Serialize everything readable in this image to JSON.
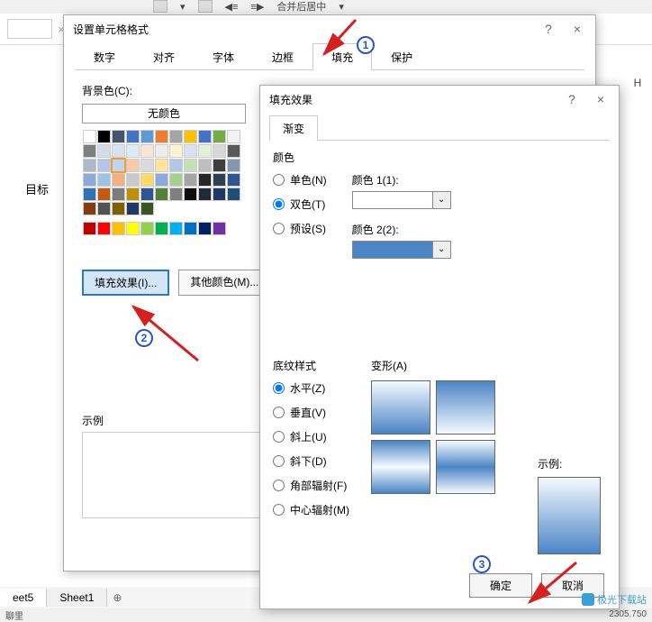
{
  "ribbon": {
    "merge_center": "合并后居中"
  },
  "spreadsheet": {
    "col_H": "H",
    "cell_label": "目标",
    "sheets": [
      "eet5",
      "Sheet1"
    ],
    "status_left": "聊里",
    "status_right": "2305.750"
  },
  "dialog1": {
    "title": "设置单元格格式",
    "help": "?",
    "close": "×",
    "tabs": [
      "数字",
      "对齐",
      "字体",
      "边框",
      "填充",
      "保护"
    ],
    "bg_color_label": "背景色(C):",
    "no_color": "无颜色",
    "fill_effects_btn": "填充效果(I)...",
    "other_colors_btn": "其他颜色(M)...",
    "example_label": "示例"
  },
  "dialog2": {
    "title": "填充效果",
    "help": "?",
    "close": "×",
    "gradient_tab": "渐变",
    "color_section": "颜色",
    "radio_one": "单色(N)",
    "radio_two": "双色(T)",
    "radio_preset": "预设(S)",
    "color1_label": "颜色 1(1):",
    "color2_label": "颜色 2(2):",
    "color2_value": "#4a85c5",
    "style_section": "底纹样式",
    "style_horizontal": "水平(Z)",
    "style_vertical": "垂直(V)",
    "style_diag_up": "斜上(U)",
    "style_diag_down": "斜下(D)",
    "style_corner": "角部辐射(F)",
    "style_center": "中心辐射(M)",
    "variants_label": "变形(A)",
    "preview_label": "示例:",
    "ok": "确定",
    "cancel": "取消"
  },
  "watermark": "极光下载站",
  "palette_theme": [
    "#ffffff",
    "#000000",
    "#44546a",
    "#4472c4",
    "#5b9bd5",
    "#ed7d31",
    "#a5a5a5",
    "#ffc000",
    "#4472c4",
    "#70ad47",
    "#f2f2f2",
    "#7f7f7f",
    "#d6dce4",
    "#d9e1f2",
    "#deeaf6",
    "#fbe4d5",
    "#ededed",
    "#fff2cc",
    "#d9e1f2",
    "#e2efd9",
    "#d8d8d8",
    "#595959",
    "#adb9ca",
    "#b4c6e7",
    "#bdd6ee",
    "#f7caac",
    "#dbdbdb",
    "#ffe598",
    "#b4c6e7",
    "#c5e0b3",
    "#bfbfbf",
    "#3f3f3f",
    "#8496b0",
    "#8eaadb",
    "#9cc2e5",
    "#f4b083",
    "#c9c9c9",
    "#ffd965",
    "#8eaadb",
    "#a8d08d",
    "#a5a5a5",
    "#262626",
    "#323f4f",
    "#2f5496",
    "#2e74b5",
    "#c45911",
    "#7b7b7b",
    "#bf8f00",
    "#2f5496",
    "#538135",
    "#7f7f7f",
    "#0c0c0c",
    "#222a35",
    "#1f3864",
    "#1f4e79",
    "#833c0b",
    "#525252",
    "#7f6000",
    "#1f3864",
    "#375623"
  ],
  "palette_standard": [
    "#c00000",
    "#ff0000",
    "#ffc000",
    "#ffff00",
    "#92d050",
    "#00b050",
    "#00b0f0",
    "#0070c0",
    "#002060",
    "#7030a0"
  ]
}
